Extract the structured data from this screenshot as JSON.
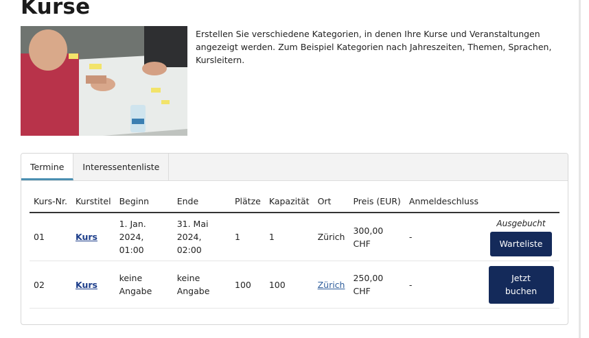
{
  "page": {
    "title": "Kurse",
    "description": "Erstellen Sie verschiedene Kategorien, in denen Ihre Kurse und Veranstaltungen angezeigt werden. Zum Beispiel Kategorien nach Jahreszeiten, Themen, Sprachen, Kursleitern."
  },
  "tabs": [
    {
      "label": "Termine",
      "active": true
    },
    {
      "label": "Interessentenliste",
      "active": false
    }
  ],
  "table": {
    "headers": [
      "Kurs-Nr.",
      "Kurstitel",
      "Beginn",
      "Ende",
      "Plätze",
      "Kapazität",
      "Ort",
      "Preis (EUR)",
      "Anmeldeschluss"
    ],
    "rows": [
      {
        "nr": "01",
        "title": "Kurs",
        "begin_date": "1. Jan. 2024,",
        "begin_time": "01:00",
        "end_date": "31. Mai 2024,",
        "end_time": "02:00",
        "places": "1",
        "capacity": "1",
        "location": "Zürich",
        "price_amount": "300,00",
        "price_currency": "CHF",
        "deadline": "-",
        "status": "Ausgebucht",
        "action": "Warteliste"
      },
      {
        "nr": "02",
        "title": "Kurs",
        "begin": "keine Angabe",
        "end": "keine Angabe",
        "places": "100",
        "capacity": "100",
        "location": "Zürich",
        "price_amount": "250,00",
        "price_currency": "CHF",
        "deadline": "-",
        "action_line1": "Jetzt",
        "action_line2": "buchen"
      }
    ]
  },
  "colors": {
    "button": "#142a5a",
    "tab_active_border": "#4a8fb1",
    "link": "#2f5e9c"
  }
}
